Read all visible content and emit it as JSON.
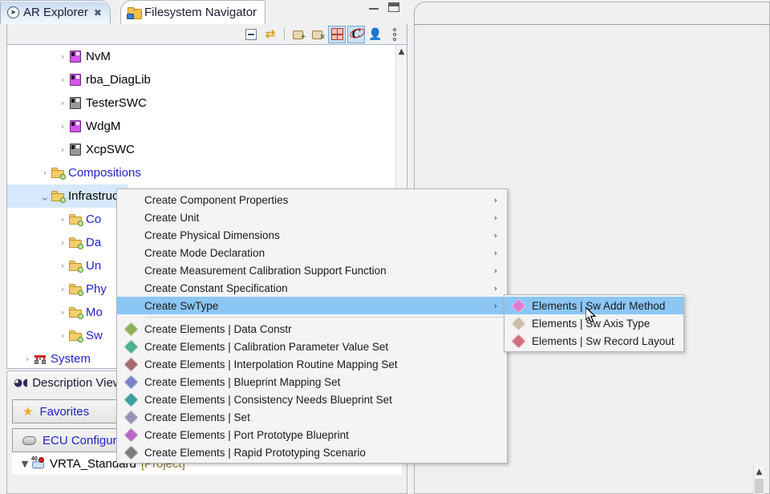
{
  "window": {
    "minimize_label": "Minimize",
    "maximize_label": "Maximize"
  },
  "view_tabs": [
    {
      "label": "AR Explorer",
      "icon": "arrow-circle-icon",
      "active": true,
      "closable": true
    },
    {
      "label": "Filesystem Navigator",
      "icon": "folder-blue-icon",
      "active": false,
      "closable": false
    }
  ],
  "toolbar": {
    "buttons": [
      {
        "name": "collapse-all-button",
        "icon": "collapse-all-icon",
        "selected": false
      },
      {
        "name": "link-with-editor-button",
        "icon": "link-editor-icon",
        "selected": false
      },
      {
        "name": "add-package-button",
        "icon": "package-add-icon",
        "selected": false
      },
      {
        "name": "remove-package-button",
        "icon": "package-remove-icon",
        "selected": false
      },
      {
        "name": "show-grid-button",
        "icon": "red-grid-icon",
        "selected": true
      },
      {
        "name": "c-filter-button",
        "icon": "c-language-icon",
        "selected": true
      },
      {
        "name": "person-filter-button",
        "icon": "person-icon",
        "selected": false
      },
      {
        "name": "view-menu-button",
        "icon": "vertical-dots-icon",
        "selected": false
      }
    ]
  },
  "tree": {
    "items": [
      {
        "label": "NvM",
        "icon": "swc-purple-icon",
        "indent": 2,
        "twisty": "collapsed",
        "blue": false,
        "selected": false
      },
      {
        "label": "rba_DiagLib",
        "icon": "swc-purple-icon",
        "indent": 2,
        "twisty": "collapsed",
        "blue": false,
        "selected": false
      },
      {
        "label": "TesterSWC",
        "icon": "swc-gray-icon",
        "indent": 2,
        "twisty": "collapsed",
        "blue": false,
        "selected": false
      },
      {
        "label": "WdgM",
        "icon": "swc-purple-icon",
        "indent": 2,
        "twisty": "collapsed",
        "blue": false,
        "selected": false
      },
      {
        "label": "XcpSWC",
        "icon": "swc-gray-icon",
        "indent": 2,
        "twisty": "collapsed",
        "blue": false,
        "selected": false
      },
      {
        "label": "Compositions",
        "icon": "package-folder-icon",
        "indent": 1,
        "twisty": "collapsed",
        "blue": true,
        "selected": false
      },
      {
        "label": "Infrastructure",
        "icon": "package-folder-icon",
        "indent": 1,
        "twisty": "expanded",
        "blue": false,
        "selected": true
      },
      {
        "label": "Co",
        "icon": "package-folder-icon",
        "indent": 2,
        "twisty": "collapsed",
        "blue": true,
        "selected": false
      },
      {
        "label": "Da",
        "icon": "package-folder-icon",
        "indent": 2,
        "twisty": "collapsed",
        "blue": true,
        "selected": false
      },
      {
        "label": "Un",
        "icon": "package-folder-icon",
        "indent": 2,
        "twisty": "collapsed",
        "blue": true,
        "selected": false
      },
      {
        "label": "Phy",
        "icon": "package-folder-icon",
        "indent": 2,
        "twisty": "collapsed",
        "blue": true,
        "selected": false
      },
      {
        "label": "Mo",
        "icon": "package-folder-icon",
        "indent": 2,
        "twisty": "collapsed",
        "blue": true,
        "selected": false
      },
      {
        "label": "Sw",
        "icon": "package-folder-icon",
        "indent": 2,
        "twisty": "collapsed",
        "blue": true,
        "selected": false
      },
      {
        "label": "System",
        "icon": "system-icon",
        "indent": 0,
        "twisty": "collapsed",
        "blue": true,
        "selected": false
      }
    ]
  },
  "description_view": {
    "tab_label": "Description View",
    "tab_icon": "glasses-icon",
    "sections": [
      {
        "label": "Favorites",
        "icon": "star-icon"
      },
      {
        "label": "ECU Configuration",
        "icon": "ecu-icon"
      }
    ],
    "project": {
      "twisty": "expanded",
      "icon": "project-icon",
      "name": "VRTA_Standard",
      "tag": "[Project]"
    }
  },
  "context_menu": {
    "items": [
      {
        "label": "Create Component Properties",
        "submenu": true,
        "icon": null,
        "highlighted": false
      },
      {
        "label": "Create Unit",
        "submenu": true,
        "icon": null,
        "highlighted": false
      },
      {
        "label": "Create Physical Dimensions",
        "submenu": true,
        "icon": null,
        "highlighted": false
      },
      {
        "label": "Create Mode Declaration",
        "submenu": true,
        "icon": null,
        "highlighted": false
      },
      {
        "label": "Create Measurement Calibration Support Function",
        "submenu": true,
        "icon": null,
        "highlighted": false
      },
      {
        "label": "Create Constant Specification",
        "submenu": true,
        "icon": null,
        "highlighted": false
      },
      {
        "label": "Create SwType",
        "submenu": true,
        "icon": null,
        "highlighted": true
      },
      {
        "separator": true
      },
      {
        "label": "Create Elements | Data Constr",
        "submenu": false,
        "icon": "diamond-icon",
        "color": "#8fae5a",
        "highlighted": false
      },
      {
        "label": "Create Elements | Calibration Parameter Value Set",
        "submenu": false,
        "icon": "diamond-icon",
        "color": "#4fae8f",
        "highlighted": false
      },
      {
        "label": "Create Elements | Interpolation Routine Mapping Set",
        "submenu": false,
        "icon": "diamond-icon",
        "color": "#a56a6a",
        "highlighted": false
      },
      {
        "label": "Create Elements | Blueprint Mapping Set",
        "submenu": false,
        "icon": "diamond-icon",
        "color": "#7d82c8",
        "highlighted": false
      },
      {
        "label": "Create Elements | Consistency Needs Blueprint Set",
        "submenu": false,
        "icon": "diamond-icon",
        "color": "#3f9e9e",
        "highlighted": false
      },
      {
        "label": "Create Elements | Set",
        "submenu": false,
        "icon": "diamond-icon",
        "color": "#9a8fb5",
        "highlighted": false
      },
      {
        "label": "Create Elements | Port Prototype Blueprint",
        "submenu": false,
        "icon": "diamond-icon",
        "color": "#b569c0",
        "highlighted": false
      },
      {
        "label": "Create Elements | Rapid Prototyping Scenario",
        "submenu": false,
        "icon": "diamond-icon",
        "color": "#7b7b7b",
        "highlighted": false
      }
    ]
  },
  "submenu": {
    "items": [
      {
        "label": "Elements | Sw Addr Method",
        "icon": "diamond-icon",
        "color": "#e07ad0",
        "highlighted": true
      },
      {
        "label": "Elements | Sw Axis Type",
        "icon": "diamond-icon",
        "color": "#cdbfa8",
        "highlighted": false
      },
      {
        "label": "Elements | Sw Record Layout",
        "icon": "diamond-icon",
        "color": "#d0707a",
        "highlighted": false
      }
    ]
  },
  "colors": {
    "menu_highlight": "#8cc6f5",
    "tree_selection": "#d6e8fb",
    "link_text": "#2222cc",
    "accent_tab": "#c8d9ee"
  }
}
